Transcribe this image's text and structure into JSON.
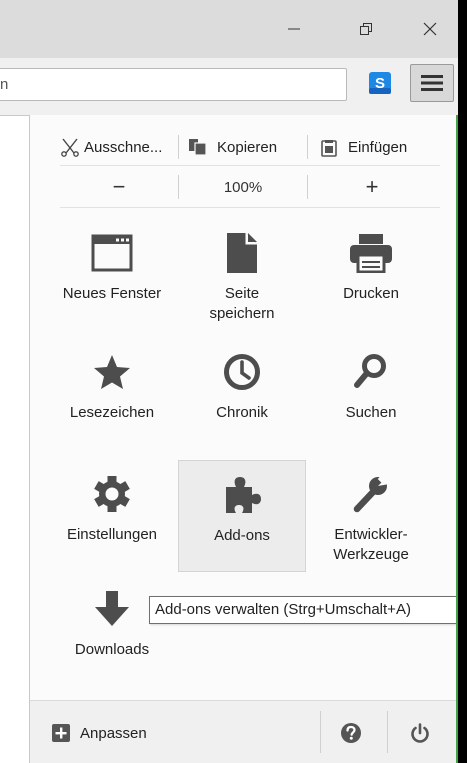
{
  "titlebar": {
    "minimize": "minimize-icon",
    "maximize": "restore-icon",
    "close": "close-icon"
  },
  "navbar": {
    "url_partial": "n",
    "extension_letter": "S",
    "menu_icon": "hamburger-icon"
  },
  "menu": {
    "edit": {
      "cut": "Ausschne...",
      "copy": "Kopieren",
      "paste": "Einfügen"
    },
    "zoom": {
      "minus": "−",
      "level": "100%",
      "plus": "+"
    },
    "items": [
      {
        "label": "Neues Fenster",
        "icon": "window-icon"
      },
      {
        "label": "Seite speichern",
        "icon": "page-icon"
      },
      {
        "label": "Drucken",
        "icon": "printer-icon"
      },
      {
        "label": "Lesezeichen",
        "icon": "star-icon"
      },
      {
        "label": "Chronik",
        "icon": "clock-icon"
      },
      {
        "label": "Suchen",
        "icon": "search-icon"
      },
      {
        "label": "Einstellungen",
        "icon": "gear-icon"
      },
      {
        "label": "Add-ons",
        "icon": "puzzle-icon"
      },
      {
        "label": "Entwickler-Werkzeuge",
        "icon": "wrench-icon"
      },
      {
        "label": "Downloads",
        "icon": "download-arrow-icon"
      }
    ],
    "tooltip": "Add-ons verwalten (Strg+Umschalt+A)",
    "footer": {
      "customize": "Anpassen",
      "help_icon": "help-icon",
      "quit_icon": "power-icon"
    }
  },
  "colors": {
    "icon_gray": "#4d4d4d",
    "extension_blue": "#1e88e5",
    "accent_green": "#45a345"
  }
}
